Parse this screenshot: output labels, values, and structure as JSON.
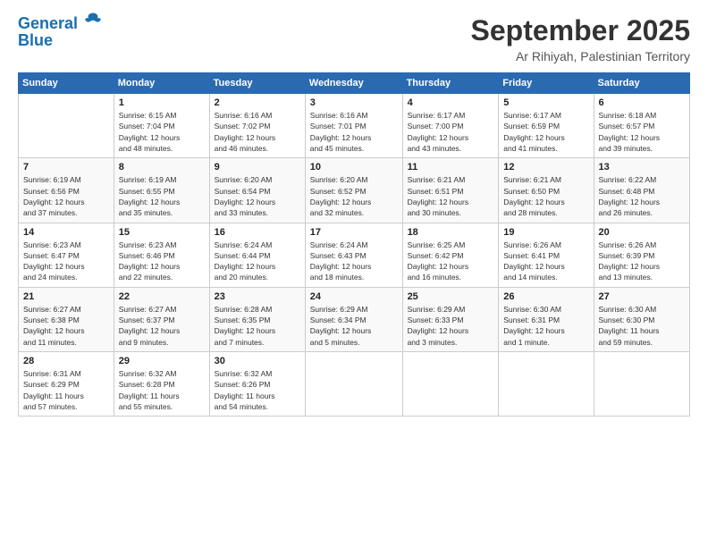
{
  "logo": {
    "line1": "General",
    "line2": "Blue"
  },
  "header": {
    "title": "September 2025",
    "subtitle": "Ar Rihiyah, Palestinian Territory"
  },
  "weekdays": [
    "Sunday",
    "Monday",
    "Tuesday",
    "Wednesday",
    "Thursday",
    "Friday",
    "Saturday"
  ],
  "weeks": [
    [
      {
        "day": "",
        "info": ""
      },
      {
        "day": "1",
        "info": "Sunrise: 6:15 AM\nSunset: 7:04 PM\nDaylight: 12 hours\nand 48 minutes."
      },
      {
        "day": "2",
        "info": "Sunrise: 6:16 AM\nSunset: 7:02 PM\nDaylight: 12 hours\nand 46 minutes."
      },
      {
        "day": "3",
        "info": "Sunrise: 6:16 AM\nSunset: 7:01 PM\nDaylight: 12 hours\nand 45 minutes."
      },
      {
        "day": "4",
        "info": "Sunrise: 6:17 AM\nSunset: 7:00 PM\nDaylight: 12 hours\nand 43 minutes."
      },
      {
        "day": "5",
        "info": "Sunrise: 6:17 AM\nSunset: 6:59 PM\nDaylight: 12 hours\nand 41 minutes."
      },
      {
        "day": "6",
        "info": "Sunrise: 6:18 AM\nSunset: 6:57 PM\nDaylight: 12 hours\nand 39 minutes."
      }
    ],
    [
      {
        "day": "7",
        "info": "Sunrise: 6:19 AM\nSunset: 6:56 PM\nDaylight: 12 hours\nand 37 minutes."
      },
      {
        "day": "8",
        "info": "Sunrise: 6:19 AM\nSunset: 6:55 PM\nDaylight: 12 hours\nand 35 minutes."
      },
      {
        "day": "9",
        "info": "Sunrise: 6:20 AM\nSunset: 6:54 PM\nDaylight: 12 hours\nand 33 minutes."
      },
      {
        "day": "10",
        "info": "Sunrise: 6:20 AM\nSunset: 6:52 PM\nDaylight: 12 hours\nand 32 minutes."
      },
      {
        "day": "11",
        "info": "Sunrise: 6:21 AM\nSunset: 6:51 PM\nDaylight: 12 hours\nand 30 minutes."
      },
      {
        "day": "12",
        "info": "Sunrise: 6:21 AM\nSunset: 6:50 PM\nDaylight: 12 hours\nand 28 minutes."
      },
      {
        "day": "13",
        "info": "Sunrise: 6:22 AM\nSunset: 6:48 PM\nDaylight: 12 hours\nand 26 minutes."
      }
    ],
    [
      {
        "day": "14",
        "info": "Sunrise: 6:23 AM\nSunset: 6:47 PM\nDaylight: 12 hours\nand 24 minutes."
      },
      {
        "day": "15",
        "info": "Sunrise: 6:23 AM\nSunset: 6:46 PM\nDaylight: 12 hours\nand 22 minutes."
      },
      {
        "day": "16",
        "info": "Sunrise: 6:24 AM\nSunset: 6:44 PM\nDaylight: 12 hours\nand 20 minutes."
      },
      {
        "day": "17",
        "info": "Sunrise: 6:24 AM\nSunset: 6:43 PM\nDaylight: 12 hours\nand 18 minutes."
      },
      {
        "day": "18",
        "info": "Sunrise: 6:25 AM\nSunset: 6:42 PM\nDaylight: 12 hours\nand 16 minutes."
      },
      {
        "day": "19",
        "info": "Sunrise: 6:26 AM\nSunset: 6:41 PM\nDaylight: 12 hours\nand 14 minutes."
      },
      {
        "day": "20",
        "info": "Sunrise: 6:26 AM\nSunset: 6:39 PM\nDaylight: 12 hours\nand 13 minutes."
      }
    ],
    [
      {
        "day": "21",
        "info": "Sunrise: 6:27 AM\nSunset: 6:38 PM\nDaylight: 12 hours\nand 11 minutes."
      },
      {
        "day": "22",
        "info": "Sunrise: 6:27 AM\nSunset: 6:37 PM\nDaylight: 12 hours\nand 9 minutes."
      },
      {
        "day": "23",
        "info": "Sunrise: 6:28 AM\nSunset: 6:35 PM\nDaylight: 12 hours\nand 7 minutes."
      },
      {
        "day": "24",
        "info": "Sunrise: 6:29 AM\nSunset: 6:34 PM\nDaylight: 12 hours\nand 5 minutes."
      },
      {
        "day": "25",
        "info": "Sunrise: 6:29 AM\nSunset: 6:33 PM\nDaylight: 12 hours\nand 3 minutes."
      },
      {
        "day": "26",
        "info": "Sunrise: 6:30 AM\nSunset: 6:31 PM\nDaylight: 12 hours\nand 1 minute."
      },
      {
        "day": "27",
        "info": "Sunrise: 6:30 AM\nSunset: 6:30 PM\nDaylight: 11 hours\nand 59 minutes."
      }
    ],
    [
      {
        "day": "28",
        "info": "Sunrise: 6:31 AM\nSunset: 6:29 PM\nDaylight: 11 hours\nand 57 minutes."
      },
      {
        "day": "29",
        "info": "Sunrise: 6:32 AM\nSunset: 6:28 PM\nDaylight: 11 hours\nand 55 minutes."
      },
      {
        "day": "30",
        "info": "Sunrise: 6:32 AM\nSunset: 6:26 PM\nDaylight: 11 hours\nand 54 minutes."
      },
      {
        "day": "",
        "info": ""
      },
      {
        "day": "",
        "info": ""
      },
      {
        "day": "",
        "info": ""
      },
      {
        "day": "",
        "info": ""
      }
    ]
  ]
}
